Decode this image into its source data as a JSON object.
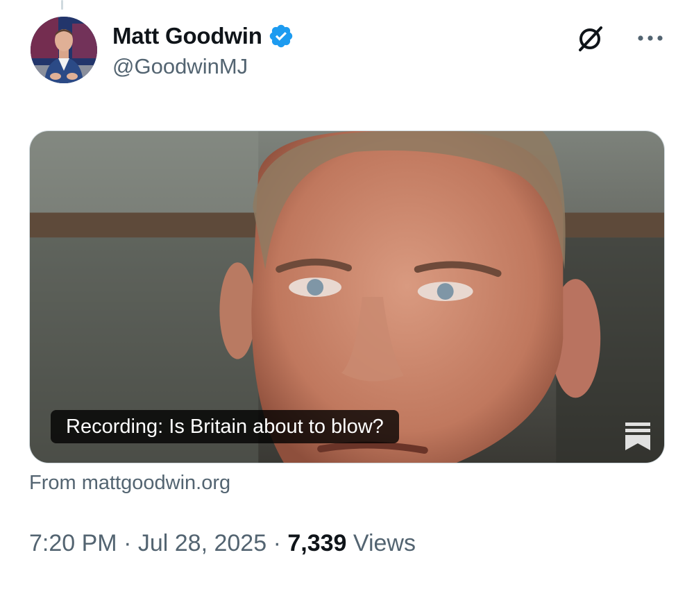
{
  "author": {
    "display_name": "Matt Goodwin",
    "handle": "@GoodwinMJ",
    "verified": true
  },
  "icons": {
    "verified": "verified-badge-icon",
    "grok": "grok-icon",
    "more": "more-options-icon",
    "publisher": "substack-icon"
  },
  "card": {
    "title": "Recording: Is Britain about to blow?",
    "source": "From mattgoodwin.org"
  },
  "meta": {
    "time": "7:20 PM",
    "separator": "·",
    "date": "Jul 28, 2025",
    "views_count": "7,339",
    "views_label": "Views"
  },
  "colors": {
    "verified_blue": "#1d9bf0",
    "secondary_text": "#536471",
    "primary_text": "#0f1419"
  }
}
